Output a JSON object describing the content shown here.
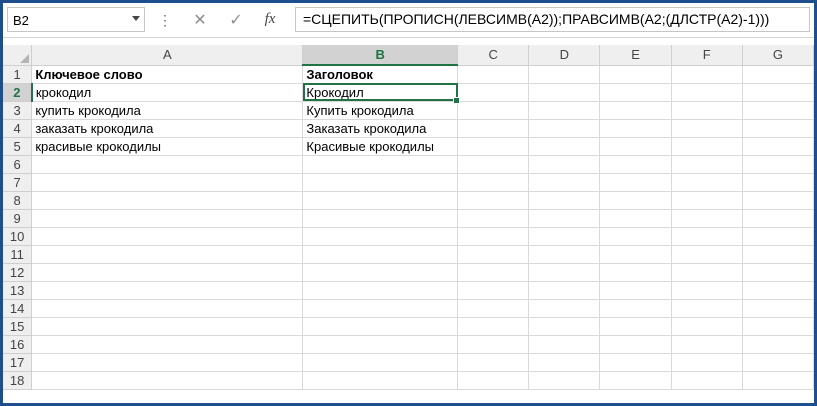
{
  "formula_bar": {
    "name_box": "B2",
    "kebab_glyph": "⋮",
    "cancel_glyph": "✕",
    "enter_glyph": "✓",
    "fx_label": "fx",
    "formula": "=СЦЕПИТЬ(ПРОПИСН(ЛЕВСИМВ(A2));ПРАВСИМВ(A2;(ДЛСТР(A2)-1)))"
  },
  "columns": [
    "A",
    "B",
    "C",
    "D",
    "E",
    "F",
    "G"
  ],
  "active_cell": {
    "column": "B",
    "row": "2"
  },
  "rows": [
    {
      "num": "1",
      "a": "Ключевое слово",
      "b": "Заголовок"
    },
    {
      "num": "2",
      "a": "крокодил",
      "b": "Крокодил"
    },
    {
      "num": "3",
      "a": "купить крокодила",
      "b": "Купить крокодила"
    },
    {
      "num": "4",
      "a": "заказать крокодила",
      "b": "Заказать крокодила"
    },
    {
      "num": "5",
      "a": "красивые крокодилы",
      "b": "Красивые крокодилы"
    },
    {
      "num": "6",
      "a": "",
      "b": ""
    },
    {
      "num": "7",
      "a": "",
      "b": ""
    },
    {
      "num": "8",
      "a": "",
      "b": ""
    },
    {
      "num": "9",
      "a": "",
      "b": ""
    },
    {
      "num": "10",
      "a": "",
      "b": ""
    },
    {
      "num": "11",
      "a": "",
      "b": ""
    },
    {
      "num": "12",
      "a": "",
      "b": ""
    },
    {
      "num": "13",
      "a": "",
      "b": ""
    },
    {
      "num": "14",
      "a": "",
      "b": ""
    },
    {
      "num": "15",
      "a": "",
      "b": ""
    },
    {
      "num": "16",
      "a": "",
      "b": ""
    },
    {
      "num": "17",
      "a": "",
      "b": ""
    },
    {
      "num": "18",
      "a": "",
      "b": ""
    }
  ],
  "colors": {
    "frame_border": "#1f4e8c",
    "selection_accent": "#217346",
    "header_bg": "#efefef",
    "gridline": "#dadada"
  }
}
